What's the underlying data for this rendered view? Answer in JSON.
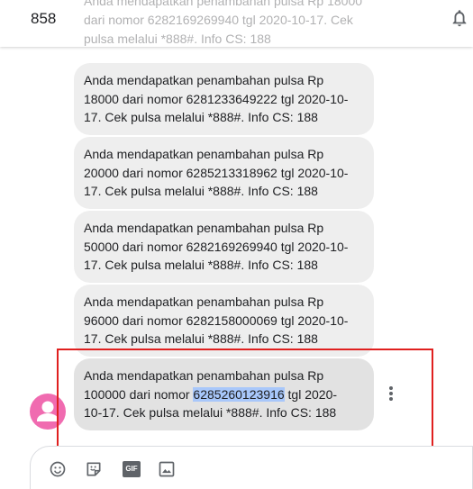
{
  "header": {
    "title": "858",
    "bell_icon": "bell-icon"
  },
  "partial_message": {
    "text": "Anda mendapatkan penambahan pulsa Rp 18000 dari nomor 6282169269940 tgl 2020-10-17. Cek pulsa melalui *888#. Info CS: 188"
  },
  "messages": [
    {
      "line1": "Anda mendapatkan penambahan pulsa Rp",
      "line2": "18000 dari nomor 6281233649222 tgl 2020-10-",
      "line3": "17. Cek pulsa melalui *888#. Info CS: 188"
    },
    {
      "line1": "Anda mendapatkan penambahan pulsa Rp",
      "line2": "20000 dari nomor 6285213318962 tgl 2020-10-",
      "line3": "17. Cek pulsa melalui *888#. Info CS: 188"
    },
    {
      "line1": "Anda mendapatkan penambahan pulsa Rp",
      "line2": "50000 dari nomor 6282169269940 tgl 2020-10-",
      "line3": "17. Cek pulsa melalui *888#. Info CS: 188"
    },
    {
      "line1": "Anda mendapatkan penambahan pulsa Rp",
      "line2": "96000 dari nomor 6282158000069 tgl 2020-10-",
      "line3": "17. Cek pulsa melalui *888#. Info CS: 188"
    }
  ],
  "last_message": {
    "line1": "Anda mendapatkan penambahan pulsa Rp",
    "line2_prefix": "100000 dari nomor ",
    "line2_highlight": "6285260123916",
    "line2_suffix": " tgl 2020-",
    "line3": "10-17. Cek pulsa melalui *888#. Info CS: 188"
  },
  "colors": {
    "avatar": "#f06bb0",
    "highlight": "#a8c7fa",
    "annotation_box": "#e0201f",
    "bubble": "#eeeeee"
  },
  "composer": {
    "icons": [
      "emoji-icon",
      "sticker-icon",
      "gif-icon",
      "image-icon"
    ],
    "gif_label": "GIF"
  }
}
